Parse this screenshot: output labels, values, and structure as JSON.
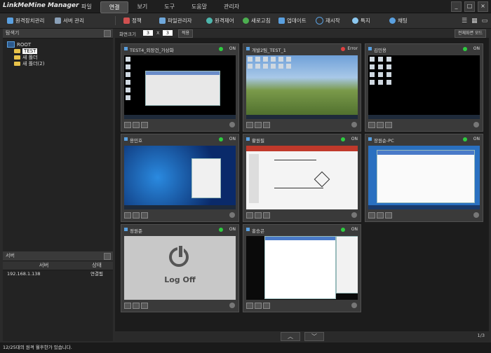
{
  "app": {
    "title": "LinkMeMine Manager"
  },
  "menu": [
    "파일",
    "연결",
    "보기",
    "도구",
    "도움말",
    "관리자"
  ],
  "window_buttons": [
    "_",
    "□",
    "×"
  ],
  "toolbar": {
    "remote_device": "원격장치관리",
    "server_manage": "서버 관리",
    "policy": "정책",
    "file_manager": "파일관리자",
    "remote_control": "원격제어",
    "refresh": "새로고침",
    "update": "업데이트",
    "restart": "재시작",
    "power": "특지",
    "chat": "채팅"
  },
  "explorer": {
    "title": "탐색기",
    "root": "ROOT",
    "items": [
      "TEST",
      "새 폴더",
      "새 폴더(2)"
    ]
  },
  "server_panel": {
    "title": "서버",
    "headers": [
      "서버",
      "상태"
    ],
    "rows": [
      {
        "server": "192.168.1.138",
        "status": "연결됨"
      }
    ]
  },
  "view": {
    "screen_size_label": "화면크기",
    "cols": "3",
    "x": "X",
    "rows": "3",
    "apply": "적용",
    "fullscreen_mode": "전체화면 모드"
  },
  "devices": [
    {
      "name": "TEST4_외장건_가상화",
      "status": "ON",
      "status_color": "#2ecc40"
    },
    {
      "name": "개발2팀_TEST_1",
      "status": "Error",
      "status_color": "#e04040"
    },
    {
      "name": "김민용",
      "status": "ON",
      "status_color": "#2ecc40"
    },
    {
      "name": "용민호",
      "status": "ON",
      "status_color": "#2ecc40"
    },
    {
      "name": "황원필",
      "status": "ON",
      "status_color": "#2ecc40"
    },
    {
      "name": "장원순-PC",
      "status": "ON",
      "status_color": "#2ecc40"
    },
    {
      "name": "정원준",
      "status": "ON",
      "status_color": "#2ecc40",
      "logoff": "Log Off"
    },
    {
      "name": "홍승곤",
      "status": "ON",
      "status_color": "#2ecc40"
    }
  ],
  "pager": {
    "up": "︿",
    "down": "﹀",
    "page": "1/3"
  },
  "statusbar": {
    "text": "12/25대의 원격 월후한가 있습니다."
  }
}
